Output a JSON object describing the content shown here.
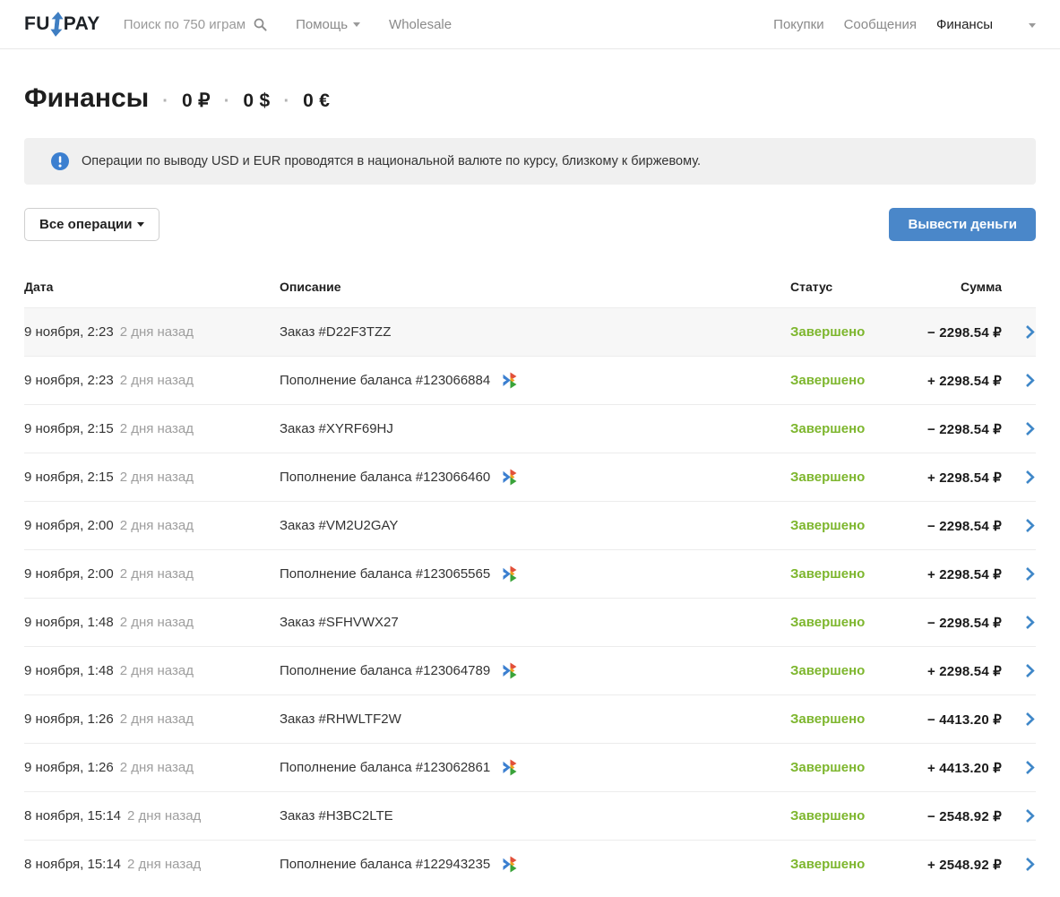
{
  "navbar": {
    "logo_part1": "FU",
    "logo_part2": "PAY",
    "search_label": "Поиск по 750 играм",
    "help_label": "Помощь",
    "wholesale_label": "Wholesale",
    "purchases_label": "Покупки",
    "messages_label": "Сообщения",
    "finances_label": "Финансы"
  },
  "page": {
    "title": "Финансы",
    "separator": "·",
    "balances": [
      "0 ₽",
      "0 $",
      "0 €"
    ]
  },
  "banner": {
    "text": "Операции по выводу USD и EUR проводятся в национальной валюте по курсу, близкому к биржевому."
  },
  "controls": {
    "filter_label": "Все операции",
    "withdraw_label": "Вывести деньги"
  },
  "table": {
    "headers": {
      "date": "Дата",
      "description": "Описание",
      "status": "Статус",
      "amount": "Сумма"
    },
    "rows": [
      {
        "date": "9 ноября, 2:23",
        "ago": "2 дня назад",
        "description": "Заказ #D22F3TZZ",
        "has_icon": false,
        "status": "Завершено",
        "amount": "− 2298.54 ₽",
        "highlighted": true
      },
      {
        "date": "9 ноября, 2:23",
        "ago": "2 дня назад",
        "description": "Пополнение баланса #123066884",
        "has_icon": true,
        "status": "Завершено",
        "amount": "+ 2298.54 ₽",
        "highlighted": false
      },
      {
        "date": "9 ноября, 2:15",
        "ago": "2 дня назад",
        "description": "Заказ #XYRF69HJ",
        "has_icon": false,
        "status": "Завершено",
        "amount": "− 2298.54 ₽",
        "highlighted": false
      },
      {
        "date": "9 ноября, 2:15",
        "ago": "2 дня назад",
        "description": "Пополнение баланса #123066460",
        "has_icon": true,
        "status": "Завершено",
        "amount": "+ 2298.54 ₽",
        "highlighted": false
      },
      {
        "date": "9 ноября, 2:00",
        "ago": "2 дня назад",
        "description": "Заказ #VM2U2GAY",
        "has_icon": false,
        "status": "Завершено",
        "amount": "− 2298.54 ₽",
        "highlighted": false
      },
      {
        "date": "9 ноября, 2:00",
        "ago": "2 дня назад",
        "description": "Пополнение баланса #123065565",
        "has_icon": true,
        "status": "Завершено",
        "amount": "+ 2298.54 ₽",
        "highlighted": false
      },
      {
        "date": "9 ноября, 1:48",
        "ago": "2 дня назад",
        "description": "Заказ #SFHVWX27",
        "has_icon": false,
        "status": "Завершено",
        "amount": "− 2298.54 ₽",
        "highlighted": false
      },
      {
        "date": "9 ноября, 1:48",
        "ago": "2 дня назад",
        "description": "Пополнение баланса #123064789",
        "has_icon": true,
        "status": "Завершено",
        "amount": "+ 2298.54 ₽",
        "highlighted": false
      },
      {
        "date": "9 ноября, 1:26",
        "ago": "2 дня назад",
        "description": "Заказ #RHWLTF2W",
        "has_icon": false,
        "status": "Завершено",
        "amount": "− 4413.20 ₽",
        "highlighted": false
      },
      {
        "date": "9 ноября, 1:26",
        "ago": "2 дня назад",
        "description": "Пополнение баланса #123062861",
        "has_icon": true,
        "status": "Завершено",
        "amount": "+ 4413.20 ₽",
        "highlighted": false
      },
      {
        "date": "8 ноября, 15:14",
        "ago": "2 дня назад",
        "description": "Заказ #H3BC2LTE",
        "has_icon": false,
        "status": "Завершено",
        "amount": "− 2548.92 ₽",
        "highlighted": false
      },
      {
        "date": "8 ноября, 15:14",
        "ago": "2 дня назад",
        "description": "Пополнение баланса #122943235",
        "has_icon": true,
        "status": "Завершено",
        "amount": "+ 2548.92 ₽",
        "highlighted": false
      }
    ]
  },
  "colors": {
    "accent_blue": "#4a87c9",
    "status_green": "#7db62d",
    "logo_blue": "#3f7ec2",
    "banner_bg": "#f0f0f0",
    "highlight_row_bg": "#f7f7f7"
  }
}
